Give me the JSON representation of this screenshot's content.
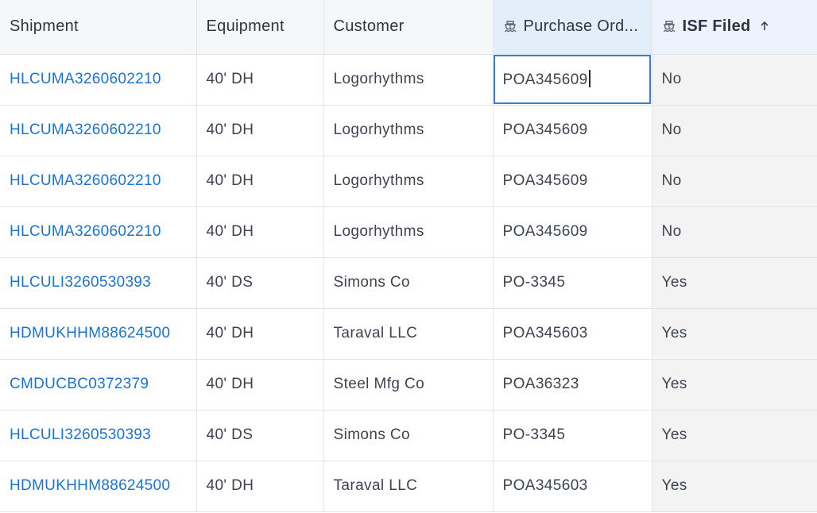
{
  "columns": {
    "shipment": "Shipment",
    "equipment": "Equipment",
    "customer": "Customer",
    "purchase_order": "Purchase Ord...",
    "isf_filed": "ISF Filed"
  },
  "icons": {
    "purchase_order_header": "ship-icon",
    "isf_filed_header": "ship-icon",
    "sort": "arrow-up-icon"
  },
  "colors": {
    "link": "#1a73d6",
    "selected_header": "#e3eefb",
    "edit_outline": "#3b7dd8"
  },
  "rows": [
    {
      "shipment": "HLCUMA3260602210",
      "equipment": "40' DH",
      "customer": "Logorhythms",
      "purchase_order": "POA345609",
      "isf_filed": "No"
    },
    {
      "shipment": "HLCUMA3260602210",
      "equipment": "40' DH",
      "customer": "Logorhythms",
      "purchase_order": "POA345609",
      "isf_filed": "No"
    },
    {
      "shipment": "HLCUMA3260602210",
      "equipment": "40' DH",
      "customer": "Logorhythms",
      "purchase_order": "POA345609",
      "isf_filed": "No"
    },
    {
      "shipment": "HLCUMA3260602210",
      "equipment": "40' DH",
      "customer": "Logorhythms",
      "purchase_order": "POA345609",
      "isf_filed": "No"
    },
    {
      "shipment": "HLCULI3260530393",
      "equipment": "40' DS",
      "customer": "Simons Co",
      "purchase_order": "PO-3345",
      "isf_filed": "Yes"
    },
    {
      "shipment": "HDMUKHHM88624500",
      "equipment": "40' DH",
      "customer": "Taraval LLC",
      "purchase_order": "POA345603",
      "isf_filed": "Yes"
    },
    {
      "shipment": "CMDUCBC0372379",
      "equipment": "40' DH",
      "customer": "Steel Mfg Co",
      "purchase_order": "POA36323",
      "isf_filed": "Yes"
    },
    {
      "shipment": "HLCULI3260530393",
      "equipment": "40' DS",
      "customer": "Simons Co",
      "purchase_order": "PO-3345",
      "isf_filed": "Yes"
    },
    {
      "shipment": "HDMUKHHM88624500",
      "equipment": "40' DH",
      "customer": "Taraval LLC",
      "purchase_order": "POA345603",
      "isf_filed": "Yes"
    }
  ]
}
